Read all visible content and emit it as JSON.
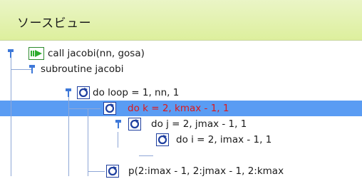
{
  "panel": {
    "title": "ソースビュー"
  },
  "tree": {
    "nodes": [
      {
        "label": "call jacobi(nn, gosa)",
        "icon": "call-arrow-icon"
      },
      {
        "label": "subroutine jacobi",
        "icon": "pin-icon"
      },
      {
        "label": "do loop = 1, nn, 1",
        "icon": "loop-icon"
      },
      {
        "label": "do k = 2, kmax - 1, 1",
        "icon": "loop-icon",
        "selected": true
      },
      {
        "label": "do j = 2, jmax - 1, 1",
        "icon": "loop-icon"
      },
      {
        "label": "do i = 2, imax - 1, 1",
        "icon": "loop-icon"
      },
      {
        "label": "p(2:imax - 1, 2:jmax - 1, 2:kmax",
        "icon": "loop-icon"
      }
    ]
  },
  "colors": {
    "title_bg": "#ddef9d",
    "selection": "#5a9cf3",
    "selected_text": "#e01818",
    "tree_lines": "#8fa7d6",
    "loop_icon": "#1f3f9f"
  }
}
